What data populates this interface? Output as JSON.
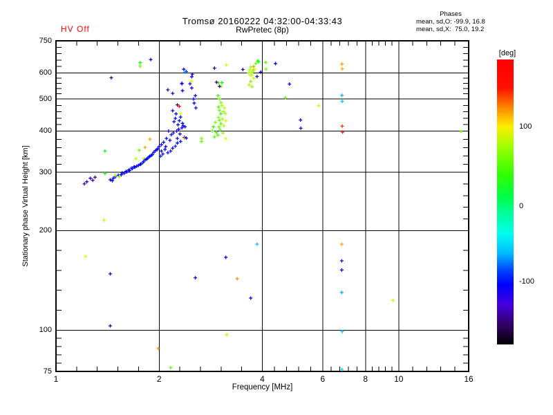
{
  "header": {
    "hv_status": "HV Off",
    "hv_color": "#ff0000",
    "title": "Tromsø 20160222 04:32:00-04:33:43",
    "subtitle": "RwPretec (8p)",
    "stats_title": "Phases",
    "stats_line_o": "mean, sd,O: -99.9, 16.8",
    "stats_line_x": "mean, sd,X:  75.0, 19.2"
  },
  "colorbar": {
    "unit_label": "[deg]",
    "value_range_deg": [
      -180,
      180
    ],
    "ticks": [
      {
        "label": "100",
        "frac": 0.235
      },
      {
        "label": "0",
        "frac": 0.515
      },
      {
        "label": "-100",
        "frac": 0.78
      }
    ]
  },
  "chart_data": {
    "type": "scatter",
    "title": "Tromsø 20160222 04:32:00-04:33:43",
    "subtitle": "RwPretec (8p)",
    "xlabel": "Frequency [MHz]",
    "ylabel": "Stationary phase Virtual Height [km]",
    "x_scale": "log",
    "y_scale": "log",
    "xlim": [
      1,
      16
    ],
    "ylim": [
      75,
      750
    ],
    "x_major_ticks": [
      1,
      2,
      4,
      6,
      8,
      10,
      16
    ],
    "y_major_ticks": [
      75,
      100,
      200,
      300,
      400,
      500,
      600,
      750
    ],
    "x_gridlines": [
      2,
      4,
      6,
      8,
      10
    ],
    "y_gridlines": [
      100,
      200,
      300,
      400,
      500,
      600
    ],
    "grid": true,
    "marker": "plus",
    "color_by": "phase_deg",
    "legend_position": "colorbar-right",
    "points_format": [
      "freq_MHz",
      "virtual_height_km",
      "phase_deg"
    ],
    "points": [
      [
        1.21,
        277,
        -125
      ],
      [
        1.23,
        281,
        -138
      ],
      [
        1.26,
        288,
        -120
      ],
      [
        1.28,
        284,
        -132
      ],
      [
        1.3,
        290,
        -150
      ],
      [
        1.44,
        285,
        -110
      ],
      [
        1.46,
        283,
        -95
      ],
      [
        1.47,
        288,
        -105
      ],
      [
        1.49,
        291,
        -112
      ],
      [
        1.49,
        294,
        65
      ],
      [
        1.52,
        294,
        -100
      ],
      [
        1.53,
        291,
        70
      ],
      [
        1.55,
        295,
        -108
      ],
      [
        1.56,
        299,
        -95
      ],
      [
        1.58,
        298,
        -115
      ],
      [
        1.6,
        302,
        -102
      ],
      [
        1.61,
        301,
        -96
      ],
      [
        1.63,
        305,
        -110
      ],
      [
        1.64,
        304,
        -100
      ],
      [
        1.66,
        309,
        -90
      ],
      [
        1.67,
        308,
        -106
      ],
      [
        1.69,
        312,
        -98
      ],
      [
        1.7,
        311,
        -112
      ],
      [
        1.71,
        330,
        80
      ],
      [
        1.72,
        313,
        -104
      ],
      [
        1.74,
        315,
        -95
      ],
      [
        1.75,
        350,
        55
      ],
      [
        1.76,
        317,
        -108
      ],
      [
        1.77,
        318,
        -100
      ],
      [
        1.79,
        321,
        -92
      ],
      [
        1.8,
        322,
        85
      ],
      [
        1.8,
        323,
        -110
      ],
      [
        1.81,
        330,
        60
      ],
      [
        1.82,
        327,
        -98
      ],
      [
        1.82,
        357,
        130
      ],
      [
        1.84,
        329,
        -105
      ],
      [
        1.85,
        331,
        -96
      ],
      [
        1.87,
        334,
        -112
      ],
      [
        1.88,
        336,
        -102
      ],
      [
        1.88,
        378,
        130
      ],
      [
        1.9,
        338,
        -94
      ],
      [
        1.91,
        340,
        -108
      ],
      [
        1.93,
        345,
        -100
      ],
      [
        1.95,
        349,
        -96
      ],
      [
        1.97,
        351,
        -110
      ],
      [
        1.98,
        354,
        -104
      ],
      [
        2.0,
        359,
        -98
      ],
      [
        2.02,
        336,
        -92
      ],
      [
        2.03,
        364,
        -106
      ],
      [
        2.03,
        348,
        -100
      ],
      [
        2.05,
        341,
        -112
      ],
      [
        2.06,
        370,
        -96
      ],
      [
        2.08,
        352,
        -104
      ],
      [
        2.09,
        359,
        -110
      ],
      [
        2.1,
        380,
        -98
      ],
      [
        2.12,
        344,
        -92
      ],
      [
        2.13,
        400,
        -106
      ],
      [
        2.15,
        375,
        -100
      ],
      [
        2.16,
        348,
        -114
      ],
      [
        2.17,
        390,
        -95
      ],
      [
        2.19,
        355,
        -108
      ],
      [
        2.19,
        461,
        -102
      ],
      [
        2.2,
        395,
        -97
      ],
      [
        2.21,
        427,
        -110
      ],
      [
        2.23,
        360,
        -90
      ],
      [
        2.23,
        437,
        -105
      ],
      [
        2.24,
        451,
        -98
      ],
      [
        2.25,
        400,
        -112
      ],
      [
        2.26,
        368,
        -100
      ],
      [
        2.26,
        380,
        -95
      ],
      [
        2.26,
        480,
        -150
      ],
      [
        2.27,
        418,
        -108
      ],
      [
        2.28,
        405,
        -102
      ],
      [
        2.29,
        475,
        170
      ],
      [
        2.29,
        430,
        -96
      ],
      [
        2.3,
        392,
        -110
      ],
      [
        2.31,
        441,
        -100
      ],
      [
        2.31,
        372,
        -94
      ],
      [
        2.31,
        452,
        85
      ],
      [
        2.33,
        409,
        -107
      ],
      [
        2.34,
        422,
        -99
      ],
      [
        2.35,
        415,
        -111
      ],
      [
        2.37,
        383,
        -103
      ],
      [
        2.37,
        381,
        130
      ],
      [
        2.38,
        412,
        -97
      ],
      [
        2.4,
        381,
        -109
      ],
      [
        2.12,
        533,
        -150
      ],
      [
        2.19,
        520,
        -115
      ],
      [
        2.34,
        530,
        -108
      ],
      [
        2.33,
        558,
        -100
      ],
      [
        2.49,
        584,
        -112
      ],
      [
        2.49,
        540,
        -105
      ],
      [
        2.52,
        500,
        -98
      ],
      [
        2.55,
        512,
        -110
      ],
      [
        2.36,
        615,
        -104
      ],
      [
        2.4,
        605,
        -96
      ],
      [
        2.38,
        603,
        -62
      ],
      [
        2.5,
        594,
        -108
      ],
      [
        2.33,
        556,
        -100
      ],
      [
        2.49,
        566,
        88
      ],
      [
        2.46,
        556,
        -115
      ],
      [
        2.53,
        486,
        -104
      ],
      [
        2.56,
        470,
        -97
      ],
      [
        2.66,
        380,
        60
      ],
      [
        2.66,
        372,
        55
      ],
      [
        2.86,
        400,
        55
      ],
      [
        2.88,
        412,
        35
      ],
      [
        2.9,
        384,
        45
      ],
      [
        2.92,
        425,
        60
      ],
      [
        2.94,
        396,
        40
      ],
      [
        2.97,
        389,
        50
      ],
      [
        2.97,
        512,
        40
      ],
      [
        2.98,
        559,
        45
      ],
      [
        2.98,
        473,
        45
      ],
      [
        2.98,
        440,
        65
      ],
      [
        2.99,
        412,
        55
      ],
      [
        3.0,
        500,
        50
      ],
      [
        3.0,
        462,
        55
      ],
      [
        3.0,
        431,
        50
      ],
      [
        3.01,
        404,
        60
      ],
      [
        3.03,
        546,
        55
      ],
      [
        3.03,
        488,
        60
      ],
      [
        3.03,
        451,
        40
      ],
      [
        3.03,
        421,
        45
      ],
      [
        3.05,
        478,
        75
      ],
      [
        3.06,
        435,
        70
      ],
      [
        3.07,
        395,
        65
      ],
      [
        3.08,
        458,
        65
      ],
      [
        3.09,
        415,
        75
      ],
      [
        3.1,
        470,
        80
      ],
      [
        3.12,
        452,
        70
      ],
      [
        3.13,
        430,
        85
      ],
      [
        3.13,
        380,
        90
      ],
      [
        3.05,
        560,
        20
      ],
      [
        2.9,
        620,
        -155
      ],
      [
        2.94,
        562,
        -150
      ],
      [
        3.0,
        546,
        -145
      ],
      [
        3.14,
        634,
        85
      ],
      [
        3.51,
        614,
        -150
      ],
      [
        3.65,
        600,
        70
      ],
      [
        3.68,
        612,
        75
      ],
      [
        3.7,
        625,
        65
      ],
      [
        3.73,
        590,
        80
      ],
      [
        3.75,
        605,
        70
      ],
      [
        3.78,
        578,
        85
      ],
      [
        3.7,
        565,
        60
      ],
      [
        3.66,
        552,
        75
      ],
      [
        3.73,
        545,
        65
      ],
      [
        3.8,
        615,
        90
      ],
      [
        3.77,
        627,
        130
      ],
      [
        3.83,
        640,
        55
      ],
      [
        3.88,
        652,
        30
      ],
      [
        3.9,
        648,
        25
      ],
      [
        3.96,
        603,
        -105
      ],
      [
        3.86,
        585,
        -115
      ],
      [
        3.72,
        600,
        78
      ],
      [
        3.76,
        612,
        68
      ],
      [
        3.69,
        590,
        82
      ],
      [
        1.45,
        580,
        -150
      ],
      [
        1.76,
        644,
        15
      ],
      [
        1.76,
        628,
        60
      ],
      [
        1.89,
        658,
        -110
      ],
      [
        1.39,
        348,
        10
      ],
      [
        1.39,
        298,
        15
      ],
      [
        4.09,
        645,
        50
      ],
      [
        4.1,
        616,
        55
      ],
      [
        4.37,
        640,
        -110
      ],
      [
        4.8,
        555,
        -110
      ],
      [
        4.67,
        505,
        55
      ],
      [
        5.84,
        477,
        80
      ],
      [
        5.17,
        432,
        -115
      ],
      [
        5.18,
        408,
        -120
      ],
      [
        6.83,
        638,
        130
      ],
      [
        6.84,
        617,
        125
      ],
      [
        6.83,
        513,
        -60
      ],
      [
        6.84,
        492,
        -55
      ],
      [
        6.84,
        414,
        165
      ],
      [
        6.86,
        397,
        170
      ],
      [
        15.2,
        399,
        55
      ],
      [
        6.82,
        182,
        130
      ],
      [
        6.82,
        162,
        -105
      ],
      [
        6.82,
        152,
        -100
      ],
      [
        6.82,
        130,
        -60
      ],
      [
        6.84,
        99,
        -55
      ],
      [
        6.83,
        76,
        -50
      ],
      [
        9.62,
        123,
        85
      ],
      [
        1.38,
        215,
        85
      ],
      [
        1.22,
        167,
        90
      ],
      [
        1.44,
        148,
        -115
      ],
      [
        1.44,
        103,
        -120
      ],
      [
        2.55,
        144,
        -130
      ],
      [
        3.13,
        166,
        -110
      ],
      [
        3.86,
        182,
        -55
      ],
      [
        3.38,
        143,
        135
      ],
      [
        3.7,
        125,
        -115
      ],
      [
        3.15,
        97,
        80
      ],
      [
        1.99,
        88,
        135
      ],
      [
        2.16,
        77,
        55
      ]
    ]
  }
}
